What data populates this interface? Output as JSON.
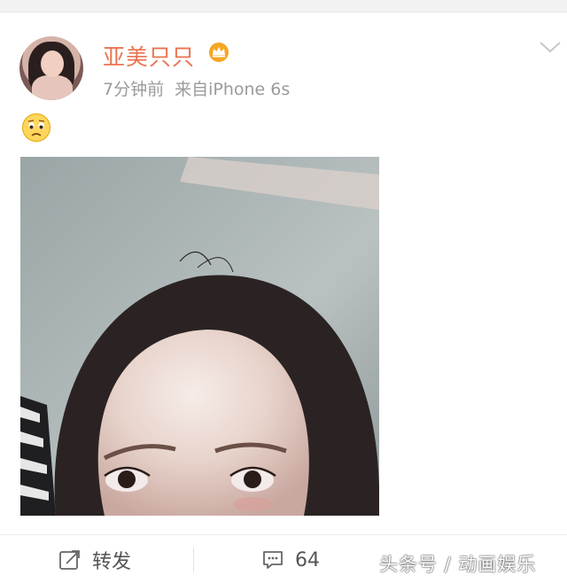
{
  "post": {
    "username": "亚美只只",
    "time": "7分钟前",
    "source": "来自iPhone 6s"
  },
  "actions": {
    "repost_label": "转发",
    "comment_count": "64"
  },
  "watermark": "头条号 / 动画娱乐",
  "colors": {
    "username": "#eb7350",
    "meta": "#9b9b9b",
    "crown": "#f5a623"
  },
  "icons": {
    "verified_badge": "crown-icon",
    "menu": "chevron-down-icon",
    "status_emoji": "sad-face-icon",
    "repost": "repost-icon",
    "comment": "comment-icon"
  }
}
